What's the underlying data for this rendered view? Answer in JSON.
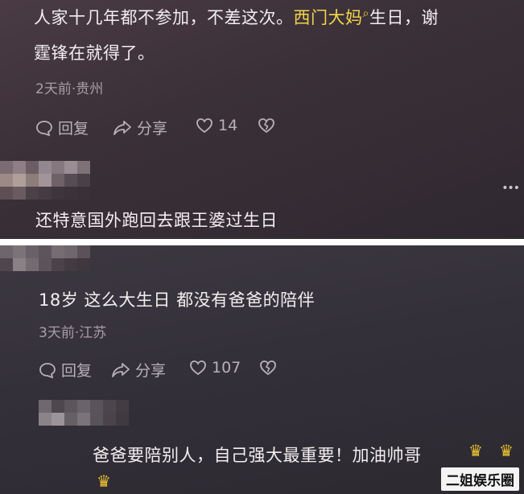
{
  "colors": {
    "panel_top_bg": "#3b3038",
    "panel_bottom_bg": "#34303a",
    "text": "#f2eef0",
    "meta_text": "#a79ea6",
    "username_highlight": "#f2d54a"
  },
  "panel_top": {
    "comment": {
      "text_line1_before": "人家十几年都不参加，不差这次。",
      "highlight_user": "西门大妈",
      "search_mark": "⌕",
      "text_line1_after": "生日，谢",
      "text_line2": "霆锋在就得了。",
      "meta": "2天前·贵州",
      "actions": {
        "reply_icon": "reply-bubble-icon",
        "reply_label": "回复",
        "share_icon": "share-arrow-icon",
        "share_label": "分享",
        "like_icon": "heart-icon",
        "like_count": "14",
        "dislike_icon": "broken-heart-icon"
      }
    },
    "reply": {
      "avatar": "blurred-avatar",
      "text": "还特意国外跑回去跟王婆过生日",
      "more_icon": "more-dots-icon"
    }
  },
  "panel_bottom": {
    "comment": {
      "avatar": "blurred-avatar",
      "text": "18岁 这么大生日 都没有爸爸的陪伴",
      "meta": "3天前·江苏",
      "actions": {
        "reply_icon": "reply-bubble-icon",
        "reply_label": "回复",
        "share_icon": "share-arrow-icon",
        "share_label": "分享",
        "like_icon": "heart-icon",
        "like_count": "107",
        "dislike_icon": "broken-heart-icon"
      }
    },
    "reply": {
      "avatar": "blurred-avatar",
      "text": "爸爸要陪别人，自己强大最重要！加油帅哥",
      "emoji_icon": "cheer-emoji-icon"
    }
  },
  "watermark": "二姐娱乐圈"
}
